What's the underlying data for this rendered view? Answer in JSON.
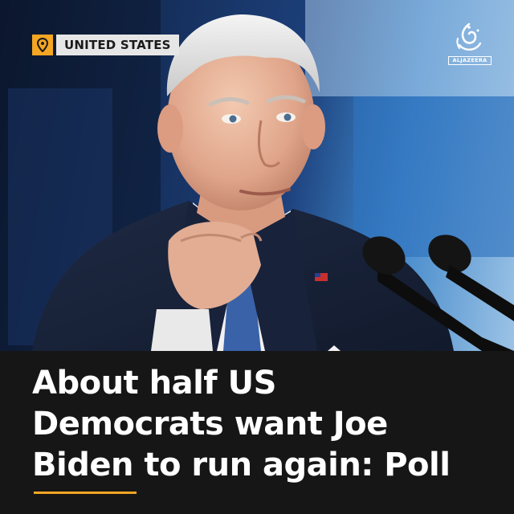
{
  "tag": {
    "icon": "location-pin-icon",
    "label": "UNITED STATES",
    "icon_color": "#f5a623"
  },
  "logo": {
    "icon": "al-jazeera-calligraphy-icon",
    "wordmark": "ALJAZEERA"
  },
  "photo": {
    "icon": "president-at-podium-photo"
  },
  "headline": {
    "lines": [
      "About half US",
      "Democrats want Joe",
      "Biden to run again: Poll"
    ]
  },
  "colors": {
    "background": "#161616",
    "accent": "#f5a623",
    "headline": "#ffffff"
  }
}
